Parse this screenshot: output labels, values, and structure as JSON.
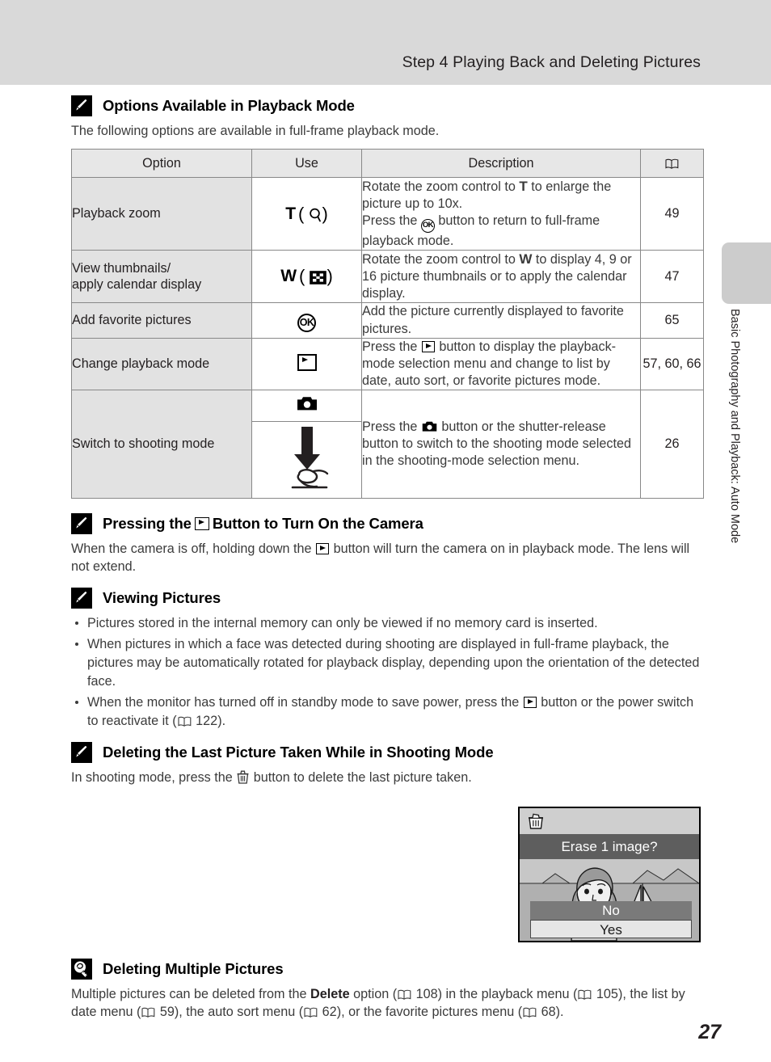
{
  "header": {
    "title": "Step 4 Playing Back and Deleting Pictures"
  },
  "side_tab": {
    "label": "Basic Photography and Playback: Auto Mode"
  },
  "sections": {
    "options_playback": {
      "icon": "pencil-note-icon",
      "title": "Options Available in Playback Mode",
      "intro": "The following options are available in full-frame playback mode."
    },
    "pressing_play": {
      "icon": "pencil-note-icon",
      "title_pre": "Pressing the",
      "title_post": "Button to Turn On the Camera",
      "body_pre": "When the camera is off, holding down the",
      "body_post": "button will turn the camera on in playback mode. The lens will not extend."
    },
    "viewing_pictures": {
      "icon": "pencil-note-icon",
      "title": "Viewing Pictures",
      "bullets": [
        {
          "text": "Pictures stored in the internal memory can only be viewed if no memory card is inserted."
        },
        {
          "text": "When pictures in which a face was detected during shooting are displayed in full-frame playback, the pictures may be automatically rotated for playback display, depending upon the orientation of the detected face."
        },
        {
          "pre": "When the monitor has turned off in standby mode to save power, press the",
          "mid": "button or the power switch to reactivate it (",
          "ref": "122",
          "post": ")."
        }
      ]
    },
    "deleting_last": {
      "icon": "pencil-note-icon",
      "title": "Deleting the Last Picture Taken While in Shooting Mode",
      "body_pre": "In shooting mode, press the",
      "body_post": "button to delete the last picture taken."
    },
    "deleting_multiple": {
      "icon": "lightbulb-tip-icon",
      "title": "Deleting Multiple Pictures",
      "body_1": "Multiple pictures can be deleted from the",
      "body_bold": "Delete",
      "body_2": "option (",
      "ref_1": "108",
      "body_3": ") in the playback menu (",
      "ref_2": "105",
      "body_4": "), the list by date menu (",
      "ref_3": "59",
      "body_5": "), the auto sort menu (",
      "ref_4": "62",
      "body_6": "), or the favorite pictures menu (",
      "ref_5": "68",
      "body_7": ")."
    }
  },
  "table": {
    "headers": {
      "option": "Option",
      "use": "Use",
      "description": "Description",
      "reference": "book-icon"
    },
    "rows": [
      {
        "option": "Playback zoom",
        "use_letter": "T",
        "use_icon": "magnifier-icon",
        "desc_line1_pre": "Rotate the zoom control to",
        "desc_line1_letter": "T",
        "desc_line1_post": "to enlarge the picture up to 10x.",
        "desc_line2_pre": "Press the",
        "desc_line2_icon": "ok-button-icon",
        "desc_line2_post": "button to return to full-frame playback mode.",
        "ref": "49"
      },
      {
        "option_line1": "View thumbnails/",
        "option_line2": "apply calendar display",
        "use_letter": "W",
        "use_icon": "thumbnail-grid-icon",
        "desc_pre": "Rotate the zoom control to",
        "desc_letter": "W",
        "desc_post": "to display 4, 9 or 16 picture thumbnails or to apply the calendar display.",
        "ref": "47"
      },
      {
        "option": "Add favorite pictures",
        "use_icon": "ok-button-icon",
        "desc": "Add the picture currently displayed to favorite pictures.",
        "ref": "65"
      },
      {
        "option": "Change playback mode",
        "use_icon": "playback-button-icon",
        "desc_pre": "Press the",
        "desc_icon": "playback-button-icon",
        "desc_post": "button to display the playback-mode selection menu and change to list by date, auto sort, or favorite pictures mode.",
        "ref": "57, 60, 66"
      },
      {
        "option": "Switch to shooting mode",
        "use_icon_top": "camera-icon",
        "use_icon_bottom": "shutter-release-arrow-icon",
        "desc_pre": "Press the",
        "desc_icon": "camera-icon",
        "desc_post": "button or the shutter-release button to switch to the shooting mode selected in the shooting-mode selection menu.",
        "ref": "26"
      }
    ]
  },
  "camera_figure": {
    "trash_icon": "trash-can-icon",
    "prompt": "Erase 1 image?",
    "choice_no": "No",
    "choice_yes": "Yes"
  },
  "footer": {
    "page_number": "27"
  }
}
